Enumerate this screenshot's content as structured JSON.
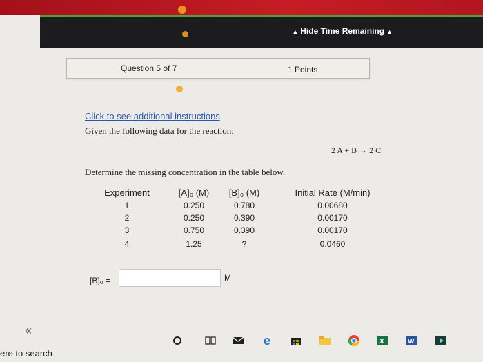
{
  "header": {
    "hide_time_label": "Hide Time Remaining"
  },
  "question": {
    "number_label": "Question 5 of 7",
    "points": "1 Points"
  },
  "instructions_link": "Click to see additional instructions",
  "given_text": "Given the following data for the reaction:",
  "reaction": "2 A  +  B  →  2 C",
  "determine_text": "Determine the missing concentration in the table below.",
  "table": {
    "headers": [
      "Experiment",
      "[A]₀ (M)",
      "[B]₀ (M)",
      "Initial Rate (M/min)"
    ],
    "rows": [
      [
        "1",
        "0.250",
        "0.780",
        "0.00680"
      ],
      [
        "2",
        "0.250",
        "0.390",
        "0.00170"
      ],
      [
        "3",
        "0.750",
        "0.390",
        "0.00170"
      ],
      [
        "4",
        "1.25",
        "?",
        "0.0460"
      ]
    ]
  },
  "answer": {
    "label": "[B]₀ =",
    "value": "",
    "unit": "M"
  },
  "nav": {
    "back": "«"
  },
  "taskbar": {
    "search_text": "ere to search"
  }
}
